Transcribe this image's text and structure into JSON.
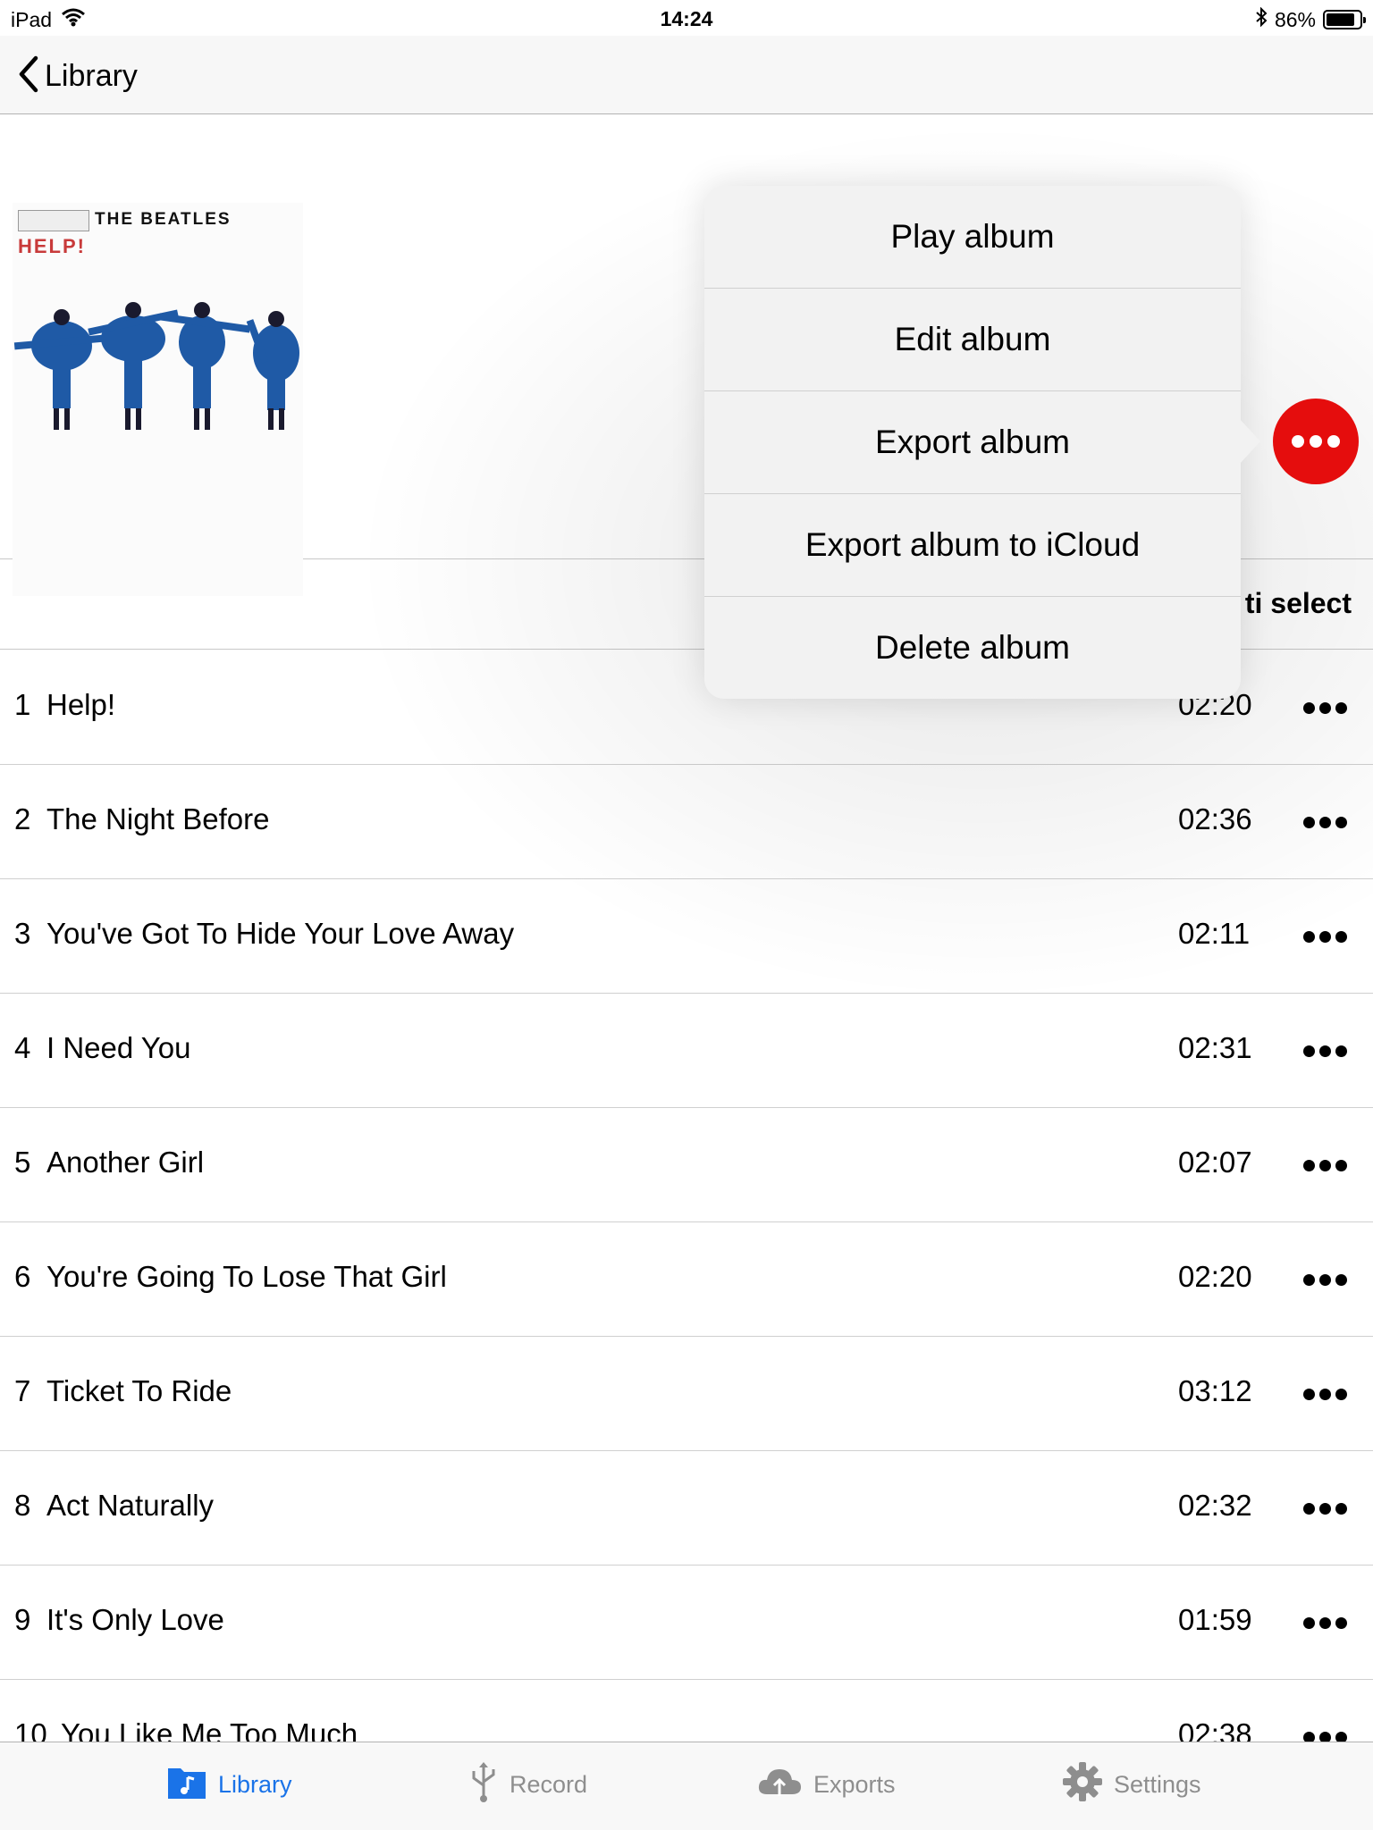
{
  "status_bar": {
    "device": "iPad",
    "time": "14:24",
    "battery": "86%",
    "battery_level": 0.86
  },
  "nav": {
    "back_label": "Library"
  },
  "album": {
    "art_title": "THE BEATLES",
    "art_subtitle": "HELP!"
  },
  "subheader": {
    "multi_select_label": "ti select"
  },
  "popover": {
    "items": [
      "Play album",
      "Edit album",
      "Export album",
      "Export album to iCloud",
      "Delete album"
    ],
    "trigger_color": "#e50d0d"
  },
  "tracks": [
    {
      "num": "1",
      "title": "Help!",
      "duration": "02:20"
    },
    {
      "num": "2",
      "title": "The Night Before",
      "duration": "02:36"
    },
    {
      "num": "3",
      "title": "You've Got To Hide Your Love Away",
      "duration": "02:11"
    },
    {
      "num": "4",
      "title": "I Need You",
      "duration": "02:31"
    },
    {
      "num": "5",
      "title": "Another Girl",
      "duration": "02:07"
    },
    {
      "num": "6",
      "title": "You're Going To Lose That Girl",
      "duration": "02:20"
    },
    {
      "num": "7",
      "title": "Ticket To Ride",
      "duration": "03:12"
    },
    {
      "num": "8",
      "title": "Act Naturally",
      "duration": "02:32"
    },
    {
      "num": "9",
      "title": "It's Only Love",
      "duration": "01:59"
    },
    {
      "num": "10",
      "title": "You Like Me Too Much",
      "duration": "02:38"
    }
  ],
  "tab_bar": {
    "tabs": [
      {
        "label": "Library",
        "icon": "folder-music-icon",
        "active": true
      },
      {
        "label": "Record",
        "icon": "usb-icon",
        "active": false
      },
      {
        "label": "Exports",
        "icon": "cloud-upload-icon",
        "active": false
      },
      {
        "label": "Settings",
        "icon": "gear-icon",
        "active": false
      }
    ],
    "accent_color": "#1a73e8"
  }
}
